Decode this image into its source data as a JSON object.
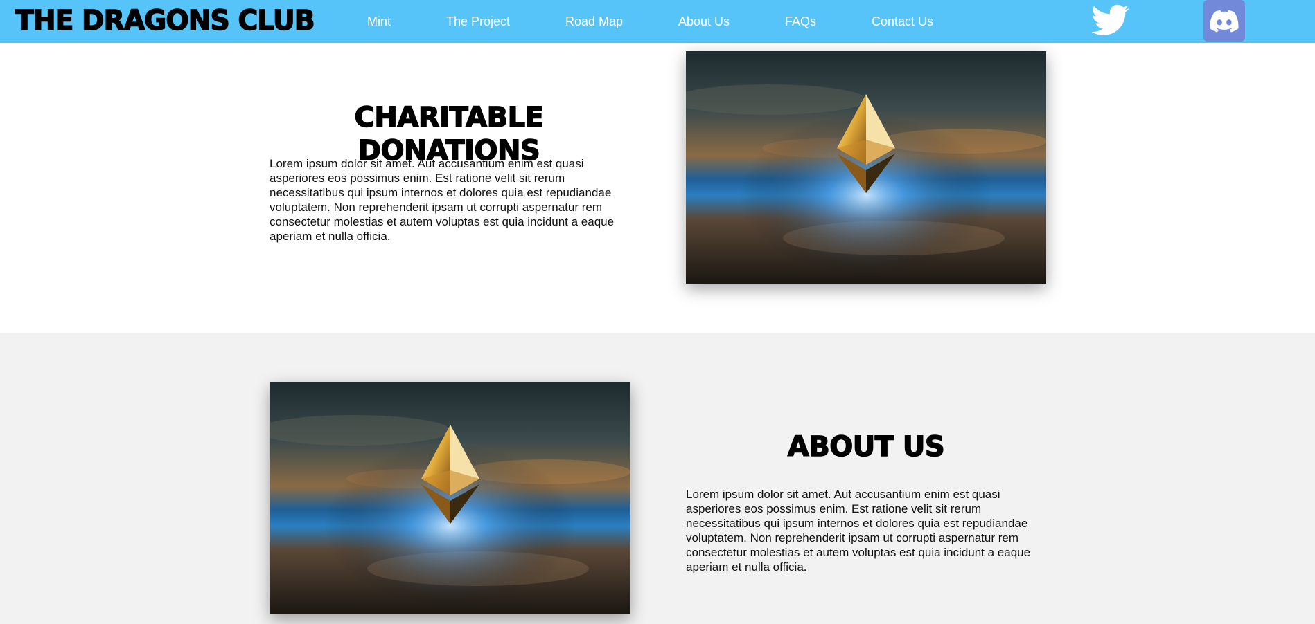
{
  "brand": {
    "title": "The Dragons Club"
  },
  "nav": {
    "links": [
      "Mint",
      "The Project",
      "Road Map",
      "About Us",
      "FAQs",
      "Contact Us"
    ]
  },
  "social": {
    "twitter_icon": "twitter-icon",
    "discord_icon": "discord-icon",
    "discord_color": "#7289da"
  },
  "colors": {
    "navbar": "#56c4f8",
    "section_white": "#ffffff",
    "section_grey": "#f2f2f2"
  },
  "sections": [
    {
      "heading": "Charitable Donations",
      "body": "Lorem ipsum dolor sit amet. Aut accusantium enim est quasi asperiores eos possimus enim. Est ratione velit sit rerum necessitatibus qui ipsum internos et dolores quia est repudiandae voluptatem. Non reprehenderit ipsam ut corrupti aspernatur rem consectetur molestias et autem voluptas est quia incidunt a eaque aperiam et nulla officia.",
      "image": "ethereum-logo-image"
    },
    {
      "heading": "About Us",
      "body": "Lorem ipsum dolor sit amet. Aut accusantium enim est quasi asperiores eos possimus enim. Est ratione velit sit rerum necessitatibus qui ipsum internos et dolores quia est repudiandae voluptatem. Non reprehenderit ipsam ut corrupti aspernatur rem consectetur molestias et autem voluptas est quia incidunt a eaque aperiam et nulla officia.",
      "image": "ethereum-logo-image"
    }
  ]
}
